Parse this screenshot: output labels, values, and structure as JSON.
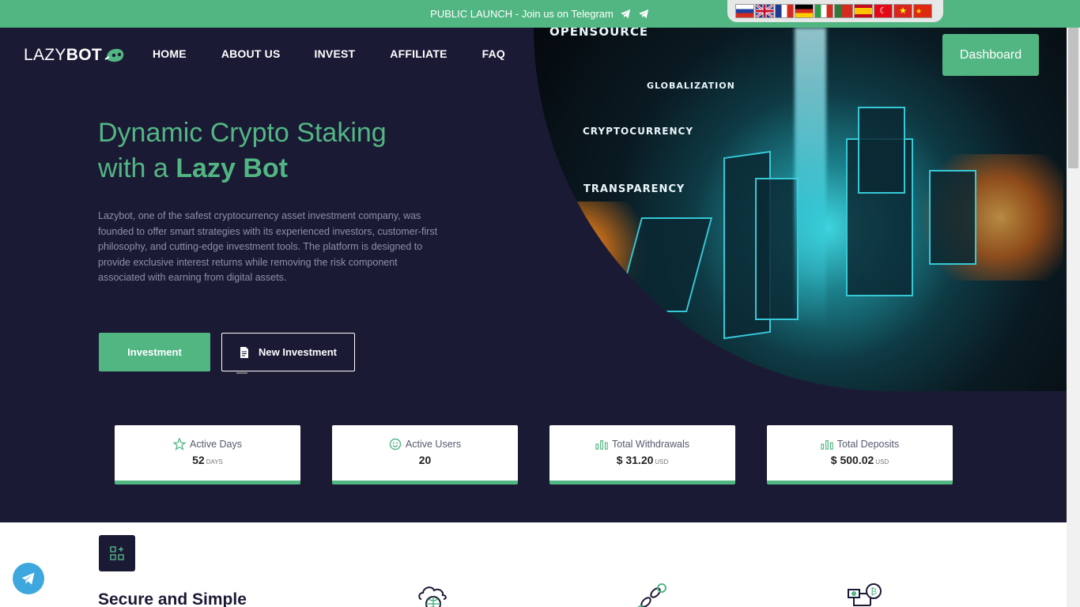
{
  "topbar": {
    "announcement": "PUBLIC LAUNCH - Join us on Telegram",
    "background": "#52b683"
  },
  "languages": [
    {
      "code": "ru",
      "icon": "flag-russia"
    },
    {
      "code": "en",
      "icon": "flag-uk"
    },
    {
      "code": "fr",
      "icon": "flag-france"
    },
    {
      "code": "de",
      "icon": "flag-germany"
    },
    {
      "code": "it",
      "icon": "flag-italy"
    },
    {
      "code": "pt",
      "icon": "flag-portugal"
    },
    {
      "code": "es",
      "icon": "flag-spain"
    },
    {
      "code": "tr",
      "icon": "flag-turkey"
    },
    {
      "code": "vi",
      "icon": "flag-vietnam"
    },
    {
      "code": "zh",
      "icon": "flag-china"
    }
  ],
  "header": {
    "logo_light": "LAZY",
    "logo_bold": "BOT",
    "nav": [
      "HOME",
      "ABOUT US",
      "INVEST",
      "AFFILIATE",
      "FAQ"
    ],
    "dashboard_label": "Dashboard"
  },
  "hero": {
    "title_line1": "Dynamic Crypto Staking",
    "title_line2_prefix": "with a",
    "title_line2_bold": "Lazy Bot",
    "description": "Lazybot, one of the safest cryptocurrency asset investment company, was founded to offer smart strategies with its experienced investors, customer-first philosophy, and cutting-edge investment tools. The platform is designed to provide exclusive interest returns while removing the risk component associated with earning from digital assets.",
    "invest_button": "Investment",
    "new_invest_button": "New Investment",
    "image_labels": [
      "OPENSOURCE",
      "GLOBALIZATION",
      "CRYPTOCURRENCY",
      "TRANSPARENCY"
    ]
  },
  "stats": [
    {
      "title": "Active Days",
      "value": "52",
      "unit": "DAYS",
      "icon": "star-icon"
    },
    {
      "title": "Active Users",
      "value": "20",
      "unit": "",
      "icon": "smile-icon"
    },
    {
      "title": "Total Withdrawals",
      "value": "$ 31.20",
      "unit": "USD",
      "icon": "bar-chart-icon"
    },
    {
      "title": "Total Deposits",
      "value": "$ 500.02",
      "unit": "USD",
      "icon": "bar-chart-icon"
    }
  ],
  "section": {
    "title": "Secure and Simple"
  },
  "colors": {
    "accent": "#52b683",
    "dark": "#1b1a35",
    "telegram": "#3ea7dd"
  }
}
